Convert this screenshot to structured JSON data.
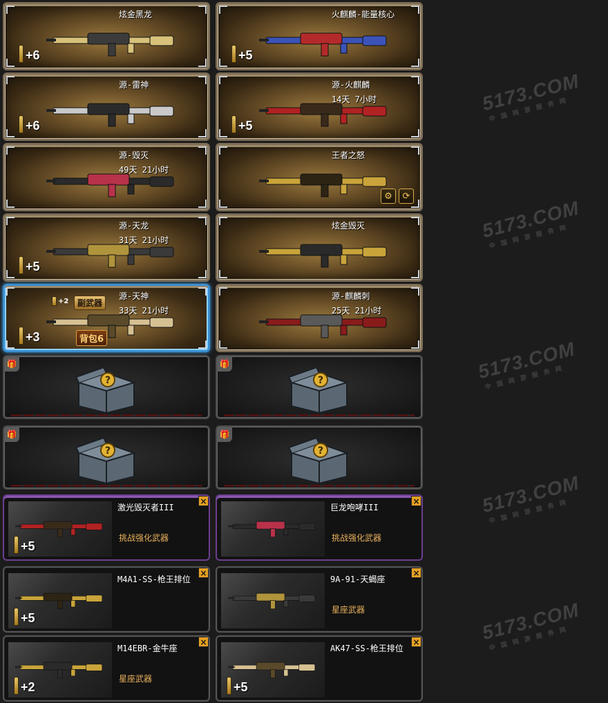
{
  "colors": {
    "background": "#1c1c1c",
    "gold_frame": "#7d6d57",
    "selected_frame": "#3a8fd1",
    "challenge_tag": "#e8b05c",
    "close_button": "#e5a023"
  },
  "weapons": [
    {
      "name": "炫金黑龙",
      "time": "",
      "plus": "+6",
      "selected": false
    },
    {
      "name": "火麒麟-能量核心",
      "time": "",
      "plus": "+5",
      "selected": false
    },
    {
      "name": "源-雷神",
      "time": "",
      "plus": "+6",
      "selected": false
    },
    {
      "name": "源-火麒麟",
      "time": "14天 7小时",
      "plus": "+5",
      "selected": false
    },
    {
      "name": "源-毁灭",
      "time": "49天 21小时",
      "plus": "",
      "selected": false
    },
    {
      "name": "王者之怒",
      "time": "",
      "plus": "",
      "selected": false
    },
    {
      "name": "源-天龙",
      "time": "31天 21小时",
      "plus": "+5",
      "selected": false
    },
    {
      "name": "炫金毁灭",
      "time": "",
      "plus": "",
      "selected": false
    },
    {
      "name": "源-天神",
      "time": "33天 21小时",
      "plus": "+3",
      "selected": true
    },
    {
      "name": "源-麒麟刺",
      "time": "25天 21小时",
      "plus": "",
      "selected": false
    }
  ],
  "selected_card": {
    "plus_small": "+2",
    "secondary_tag": "副武器",
    "bag_tag": "背包6"
  },
  "mystery_boxes": [
    {
      "icon": "gift-icon"
    },
    {
      "icon": "gift-icon"
    },
    {
      "icon": "gift-icon"
    },
    {
      "icon": "gift-icon"
    }
  ],
  "challenges": [
    {
      "name": "激光毁灭者III",
      "tag": "挑战强化武器",
      "plus": "+5",
      "frame": "purple"
    },
    {
      "name": "巨龙咆哮III",
      "tag": "挑战强化武器",
      "plus": "",
      "frame": "purple"
    },
    {
      "name": "M4A1-SS-枪王排位",
      "tag": "",
      "plus": "+5",
      "frame": "gray"
    },
    {
      "name": "9A-91-天蝎座",
      "tag": "星座武器",
      "plus": "",
      "frame": "gray"
    },
    {
      "name": "M14EBR-金牛座",
      "tag": "星座武器",
      "plus": "+2",
      "frame": "gray"
    },
    {
      "name": "AK47-SS-枪王排位",
      "tag": "",
      "plus": "+5",
      "frame": "gray"
    }
  ],
  "close_label": "×",
  "watermark": {
    "text": "5173.COM",
    "sub": "中 国 网 游 服 务 网"
  }
}
